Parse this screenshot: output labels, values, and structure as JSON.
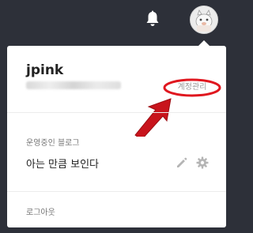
{
  "topbar": {
    "bell_icon": "bell-icon",
    "avatar_icon": "user-avatar"
  },
  "menu": {
    "username": "jpink",
    "account_manage_label": "계정관리",
    "blogs_section_label": "운영중인 블로그",
    "blog_name": "아는 만큼 보인다",
    "edit_icon": "pencil-icon",
    "settings_icon": "gear-icon",
    "logout_label": "로그아웃"
  },
  "annotation": {
    "highlight_color": "#e0171f",
    "arrow_color": "#c8141c"
  }
}
